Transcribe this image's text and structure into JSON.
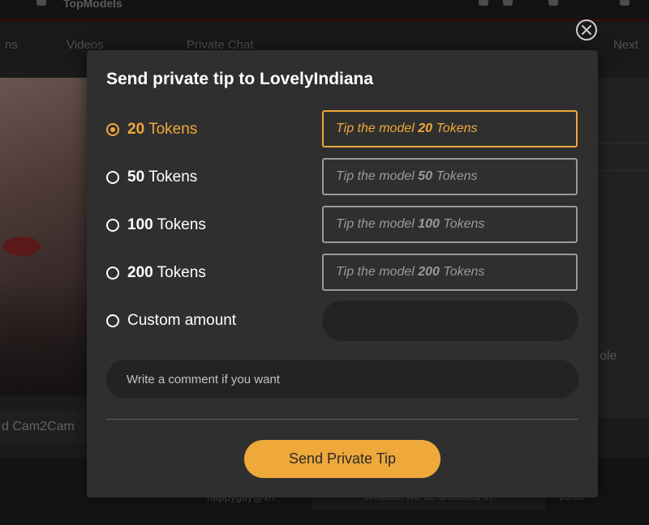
{
  "background": {
    "brand": "TopModels",
    "nav": [
      "ns",
      "Videos",
      "Private Chat",
      "Next"
    ],
    "cam_label": "d Cam2Cam",
    "side_text": "ole",
    "bottom_user": "happyguy@xh",
    "bottom_msg": "Whitelist will be unlocked in",
    "bottom_time": "10:00"
  },
  "modal": {
    "title": "Send private tip to LovelyIndiana",
    "options": [
      {
        "amount": "20",
        "unit": "Tokens",
        "tip_prefix": "Tip the model",
        "selected": true
      },
      {
        "amount": "50",
        "unit": "Tokens",
        "tip_prefix": "Tip the model",
        "selected": false
      },
      {
        "amount": "100",
        "unit": "Tokens",
        "tip_prefix": "Tip the model",
        "selected": false
      },
      {
        "amount": "200",
        "unit": "Tokens",
        "tip_prefix": "Tip the model",
        "selected": false
      }
    ],
    "custom_label": "Custom amount",
    "custom_value": "",
    "comment_placeholder": "Write a comment if you want",
    "send_label": "Send Private Tip"
  },
  "colors": {
    "accent": "#efa83a",
    "modal_bg": "#2f2f2f",
    "input_bg": "#232323"
  },
  "icons": {
    "close": "close-icon"
  }
}
